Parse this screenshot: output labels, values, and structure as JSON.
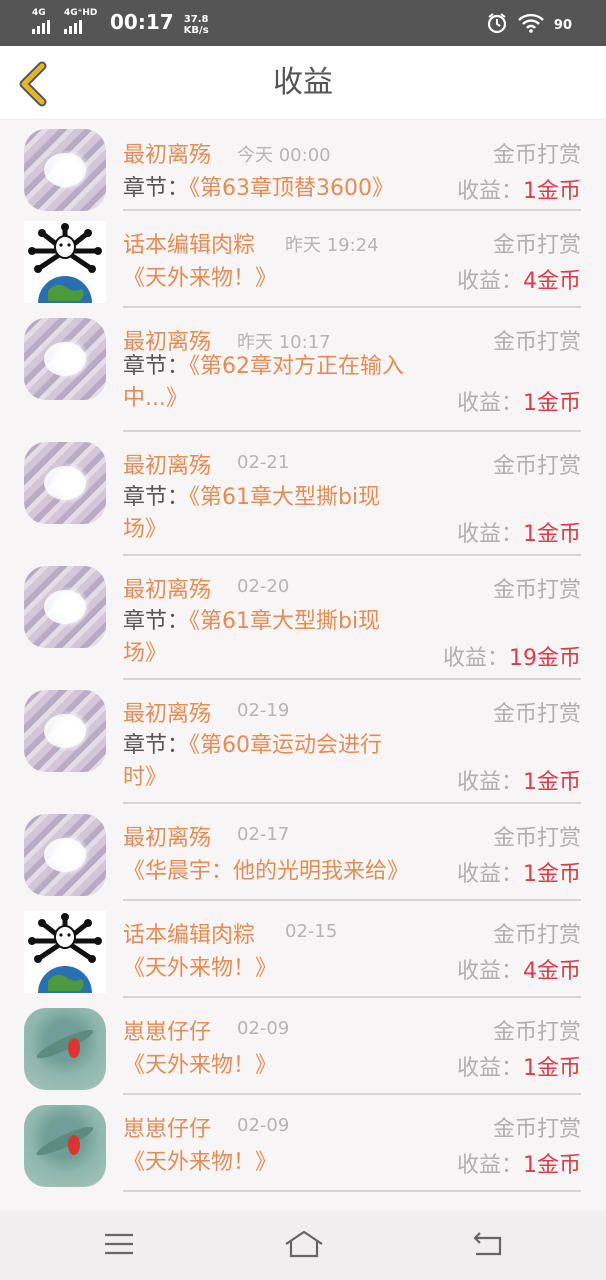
{
  "status_bar": {
    "network1": "4G",
    "network2": "4G⁺HD",
    "time": "00:17",
    "speed_value": "37.8",
    "speed_unit": "KB/s",
    "battery": "90"
  },
  "header": {
    "title": "收益"
  },
  "entries": [
    {
      "avatar": "girl",
      "user": "最初离殇",
      "time": "今天 00:00",
      "type": "金币打赏",
      "prefix": "章节：",
      "work_line1": "《第63章顶替3600》",
      "work_line2": "",
      "earn_label": "收益：",
      "earn_amount": "1金币"
    },
    {
      "avatar": "globe",
      "user": "话本编辑肉粽",
      "time": "昨天 19:24",
      "type": "金币打赏",
      "prefix": "",
      "work_line1": "《天外来物！》",
      "work_line2": "",
      "earn_label": "收益：",
      "earn_amount": "4金币"
    },
    {
      "avatar": "girl",
      "user": "最初离殇",
      "time": "昨天 10:17",
      "type": "金币打赏",
      "prefix": "章节：",
      "work_line1": "《第62章对方正在输入",
      "work_line2": "中...》",
      "earn_label": "收益：",
      "earn_amount": "1金币"
    },
    {
      "avatar": "girl",
      "user": "最初离殇",
      "time": "02-21",
      "type": "金币打赏",
      "prefix": "章节：",
      "work_line1": "《第61章大型撕bi现",
      "work_line2": "场》",
      "earn_label": "收益：",
      "earn_amount": "1金币"
    },
    {
      "avatar": "girl",
      "user": "最初离殇",
      "time": "02-20",
      "type": "金币打赏",
      "prefix": "章节：",
      "work_line1": "《第61章大型撕bi现",
      "work_line2": "场》",
      "earn_label": "收益：",
      "earn_amount": "19金币"
    },
    {
      "avatar": "girl",
      "user": "最初离殇",
      "time": "02-19",
      "type": "金币打赏",
      "prefix": "章节：",
      "work_line1": "《第60章运动会进行",
      "work_line2": "时》",
      "earn_label": "收益：",
      "earn_amount": "1金币"
    },
    {
      "avatar": "girl",
      "user": "最初离殇",
      "time": "02-17",
      "type": "金币打赏",
      "prefix": "",
      "work_line1": "《华晨宇：他的光明我来给》",
      "work_line2": "",
      "earn_label": "收益：",
      "earn_amount": "1金币"
    },
    {
      "avatar": "globe",
      "user": "话本编辑肉粽",
      "time": "02-15",
      "type": "金币打赏",
      "prefix": "",
      "work_line1": "《天外来物！》",
      "work_line2": "",
      "earn_label": "收益：",
      "earn_amount": "4金币"
    },
    {
      "avatar": "teal",
      "user": "崽崽仔仔",
      "time": "02-09",
      "type": "金币打赏",
      "prefix": "",
      "work_line1": "《天外来物！》",
      "work_line2": "",
      "earn_label": "收益：",
      "earn_amount": "1金币"
    },
    {
      "avatar": "teal",
      "user": "崽崽仔仔",
      "time": "02-09",
      "type": "金币打赏",
      "prefix": "",
      "work_line1": "《天外来物！》",
      "work_line2": "",
      "earn_label": "收益：",
      "earn_amount": "1金币"
    }
  ],
  "icons": {
    "back": "chevron-left-icon",
    "menu": "menu-icon",
    "home": "home-icon",
    "return": "return-icon"
  },
  "colors": {
    "accent_orange": "#e38c55",
    "earn_red": "#dc3b48",
    "back_chevron": "#e6b62a"
  }
}
